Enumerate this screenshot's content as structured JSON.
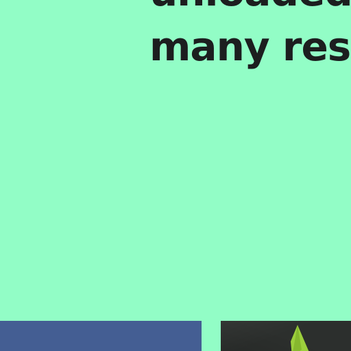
{
  "article": {
    "headline_line1": "unloaded. ",
    "headline_line2": "many restr"
  },
  "cards": {
    "left_color": "#445e93",
    "right_color": "#2c2f2d",
    "accent_color": "#9ccf3c"
  }
}
